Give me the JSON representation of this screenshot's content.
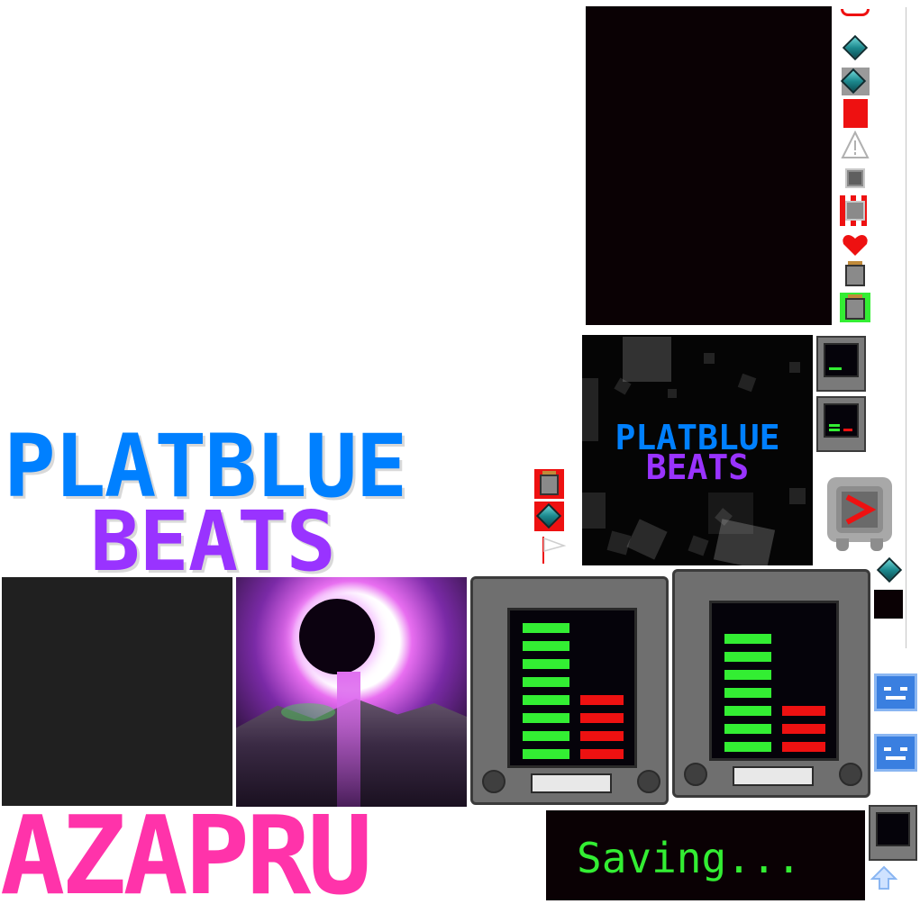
{
  "title": {
    "line1": "PLATBLUE",
    "line2": "BEATS"
  },
  "cover": {
    "line1": "PLATBLUE",
    "line2": "BEATS"
  },
  "artist": "AZAPRU",
  "saving": {
    "text": "Saving..."
  },
  "colors": {
    "blue": "#0080ff",
    "purple": "#9933ff",
    "pink": "#ff33aa",
    "green": "#33ee33",
    "red": "#ee1111",
    "teal": "#1d8a8f",
    "black": "#0a0104"
  },
  "icons": [
    "red-bracket-icon",
    "teal-gem-icon",
    "teal-gem-grey-icon",
    "red-square-icon",
    "warning-triangle-icon",
    "grey-chip-icon",
    "red-chip-icon",
    "heart-icon",
    "battery-icon",
    "battery-green-icon",
    "battery-red-icon",
    "gem-red-icon",
    "flag-icon",
    "speaker-icon",
    "blue-face-icon",
    "blue-face-2-icon",
    "up-arrow-icon"
  ]
}
